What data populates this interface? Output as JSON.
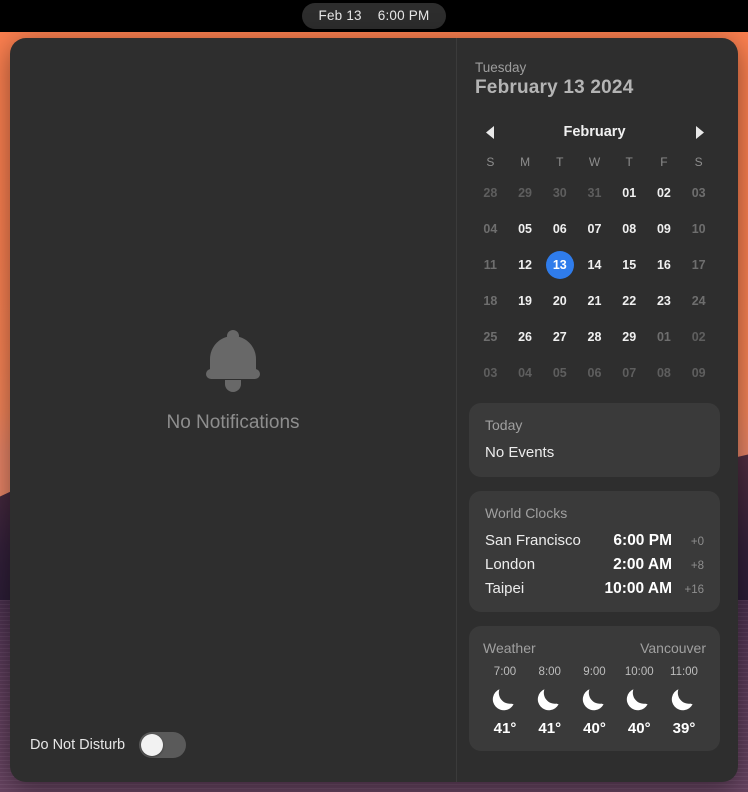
{
  "menubar": {
    "date": "Feb 13",
    "time": "6:00 PM"
  },
  "notifications": {
    "empty_label": "No Notifications",
    "bell_icon": "bell-icon",
    "do_not_disturb": {
      "label": "Do Not Disturb",
      "enabled": false
    }
  },
  "date_header": {
    "weekday": "Tuesday",
    "full_date": "February 13 2024"
  },
  "calendar": {
    "month": "February",
    "prev_icon": "chevron-left-icon",
    "next_icon": "chevron-right-icon",
    "dow": [
      "S",
      "M",
      "T",
      "W",
      "T",
      "F",
      "S"
    ],
    "weeks": [
      [
        {
          "d": "28",
          "s": "other"
        },
        {
          "d": "29",
          "s": "other"
        },
        {
          "d": "30",
          "s": "other"
        },
        {
          "d": "31",
          "s": "other"
        },
        {
          "d": "01",
          "s": "on"
        },
        {
          "d": "02",
          "s": "on"
        },
        {
          "d": "03",
          "s": "dim"
        }
      ],
      [
        {
          "d": "04",
          "s": "dim"
        },
        {
          "d": "05",
          "s": "on"
        },
        {
          "d": "06",
          "s": "on"
        },
        {
          "d": "07",
          "s": "on"
        },
        {
          "d": "08",
          "s": "on"
        },
        {
          "d": "09",
          "s": "on"
        },
        {
          "d": "10",
          "s": "dim"
        }
      ],
      [
        {
          "d": "11",
          "s": "dim"
        },
        {
          "d": "12",
          "s": "on"
        },
        {
          "d": "13",
          "s": "today"
        },
        {
          "d": "14",
          "s": "on"
        },
        {
          "d": "15",
          "s": "on"
        },
        {
          "d": "16",
          "s": "on"
        },
        {
          "d": "17",
          "s": "dim"
        }
      ],
      [
        {
          "d": "18",
          "s": "dim"
        },
        {
          "d": "19",
          "s": "on"
        },
        {
          "d": "20",
          "s": "on"
        },
        {
          "d": "21",
          "s": "on"
        },
        {
          "d": "22",
          "s": "on"
        },
        {
          "d": "23",
          "s": "on"
        },
        {
          "d": "24",
          "s": "dim"
        }
      ],
      [
        {
          "d": "25",
          "s": "dim"
        },
        {
          "d": "26",
          "s": "on"
        },
        {
          "d": "27",
          "s": "on"
        },
        {
          "d": "28",
          "s": "on"
        },
        {
          "d": "29",
          "s": "on"
        },
        {
          "d": "01",
          "s": "dim"
        },
        {
          "d": "02",
          "s": "other"
        }
      ],
      [
        {
          "d": "03",
          "s": "other"
        },
        {
          "d": "04",
          "s": "other"
        },
        {
          "d": "05",
          "s": "other"
        },
        {
          "d": "06",
          "s": "other"
        },
        {
          "d": "07",
          "s": "other"
        },
        {
          "d": "08",
          "s": "other"
        },
        {
          "d": "09",
          "s": "other"
        }
      ]
    ]
  },
  "today_widget": {
    "title": "Today",
    "value": "No Events"
  },
  "world_clocks": {
    "title": "World Clocks",
    "rows": [
      {
        "city": "San Francisco",
        "time": "6:00 PM",
        "offset": "+0"
      },
      {
        "city": "London",
        "time": "2:00 AM",
        "offset": "+8"
      },
      {
        "city": "Taipei",
        "time": "10:00 AM",
        "offset": "+16"
      }
    ]
  },
  "weather": {
    "title": "Weather",
    "city": "Vancouver",
    "hours": [
      {
        "hour": "7:00",
        "icon": "moon-icon",
        "temp": "41°"
      },
      {
        "hour": "8:00",
        "icon": "moon-icon",
        "temp": "41°"
      },
      {
        "hour": "9:00",
        "icon": "moon-icon",
        "temp": "40°"
      },
      {
        "hour": "10:00",
        "icon": "moon-icon",
        "temp": "40°"
      },
      {
        "hour": "11:00",
        "icon": "moon-icon",
        "temp": "39°"
      }
    ]
  },
  "colors": {
    "accent": "#2f7ceb",
    "panel_bg": "#2e2e2e",
    "card_bg": "#3a3a3a",
    "wallpaper_sky": "#fb7f4f",
    "wallpaper_water": "#63405f"
  }
}
